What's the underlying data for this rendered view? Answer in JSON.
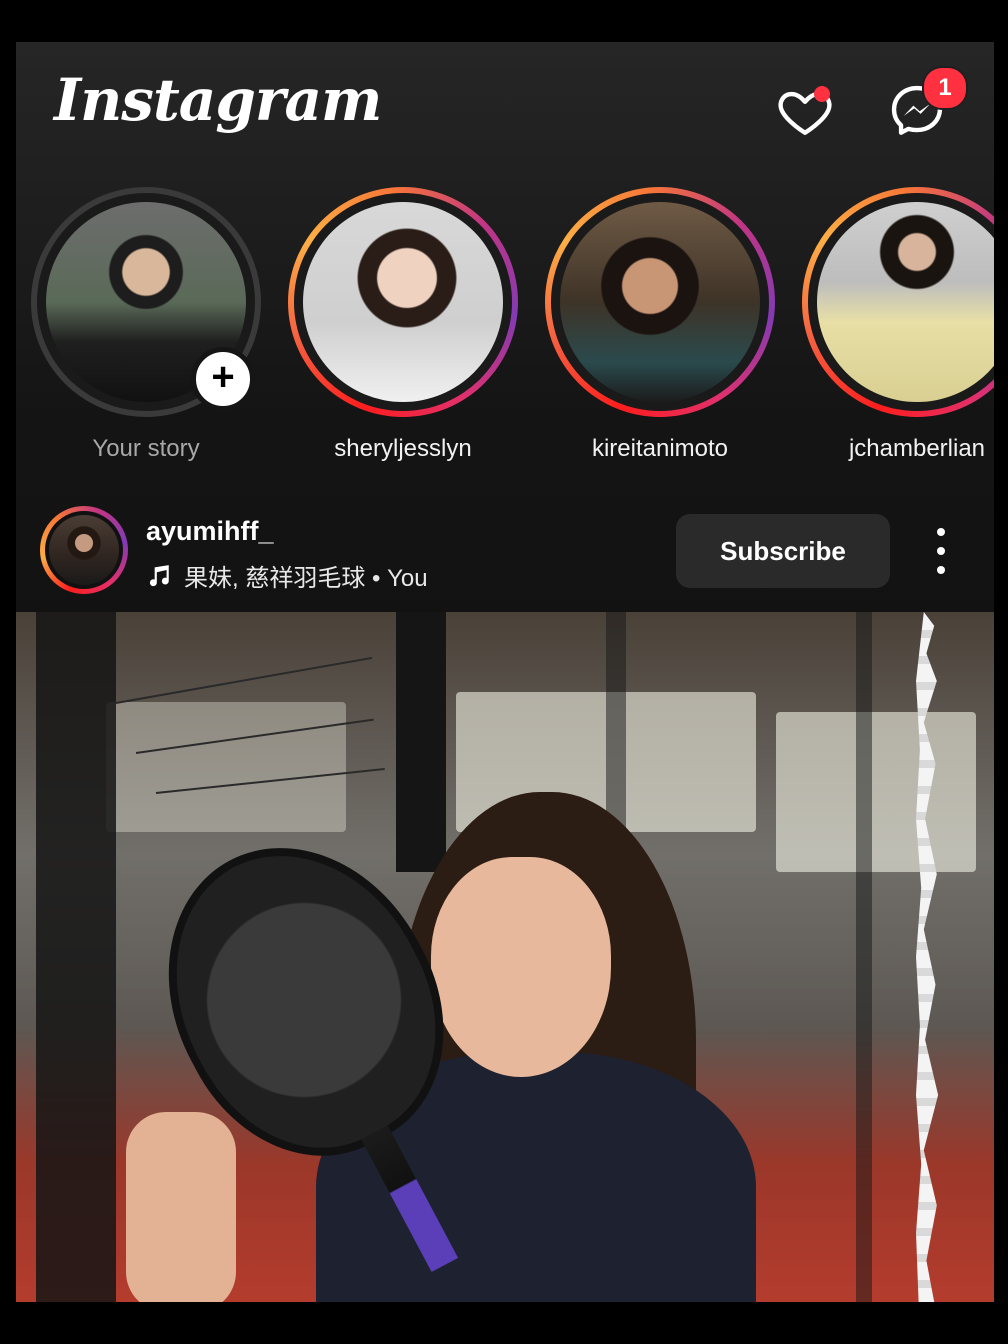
{
  "app": {
    "logo_text": "Instagram",
    "activity_icon": "heart-icon",
    "messages_icon": "messenger-icon",
    "messages_badge": "1",
    "notification_color": "#ff3040"
  },
  "stories": [
    {
      "username": "Your story",
      "own": true
    },
    {
      "username": "sheryljesslyn",
      "own": false
    },
    {
      "username": "kireitanimoto",
      "own": false
    },
    {
      "username": "jchamberlian",
      "own": false
    }
  ],
  "post": {
    "username": "ayumihff_",
    "music_icon": "music-note-icon",
    "music_text": "果妹, 慈祥羽毛球 • You",
    "subscribe_label": "Subscribe",
    "more_icon": "more-vertical-icon"
  }
}
